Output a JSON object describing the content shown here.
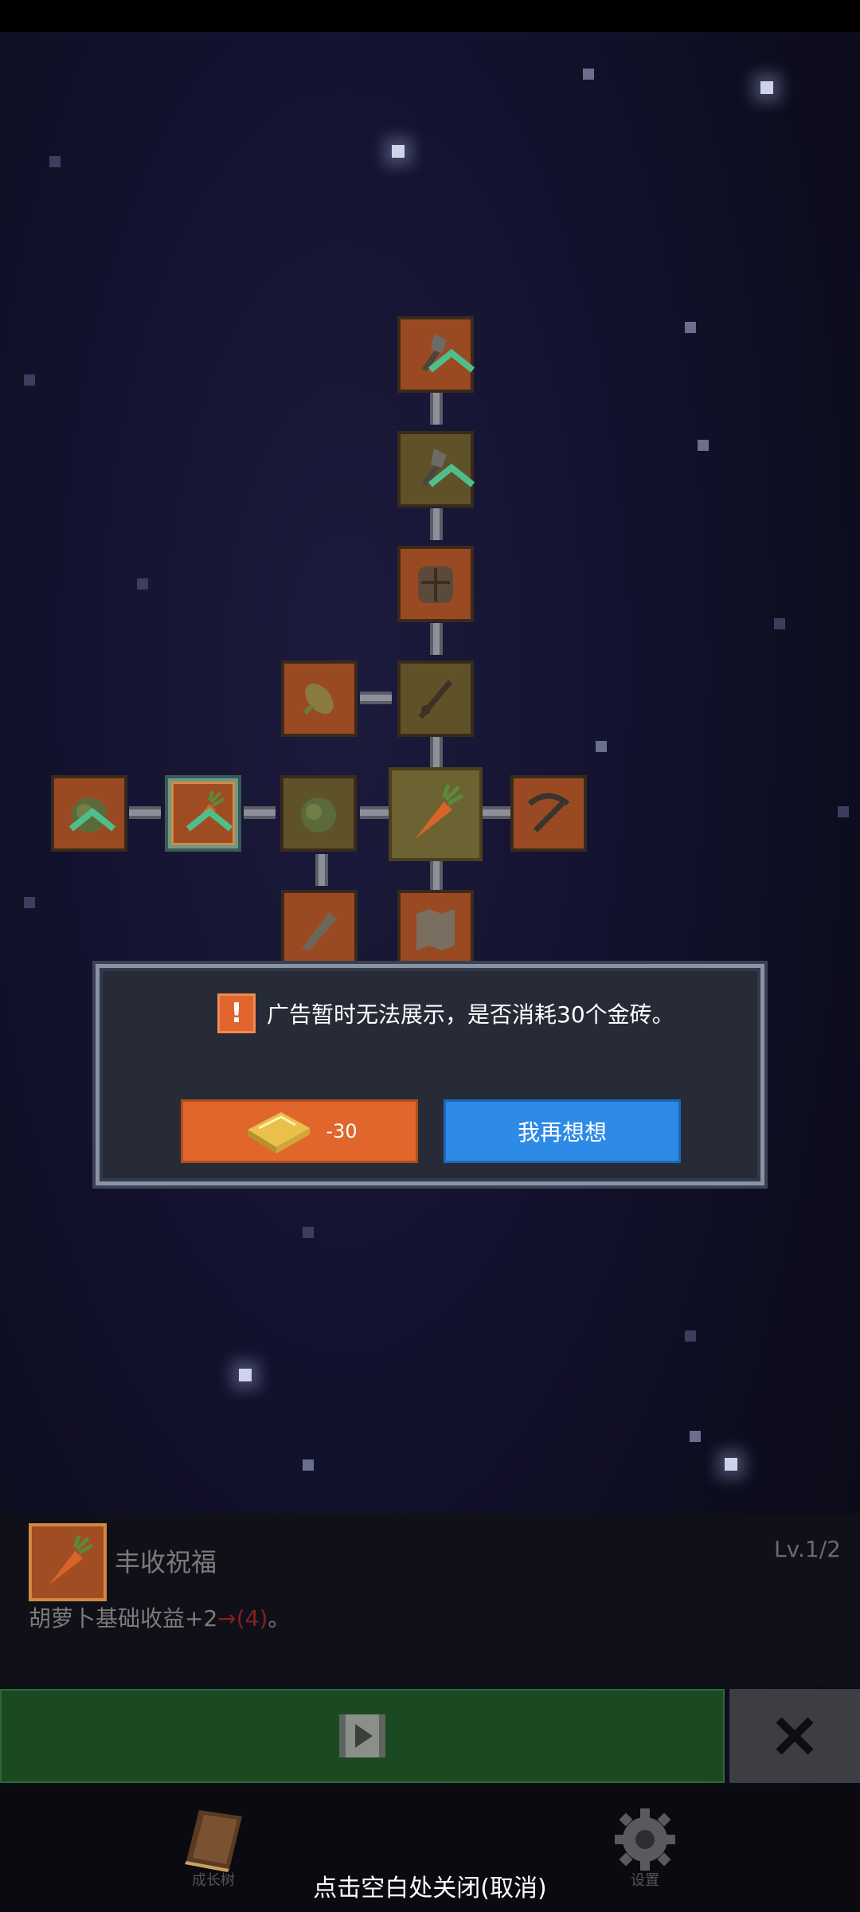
{
  "dialog": {
    "message": "广告暂时无法展示，是否消耗30个金砖。",
    "gold_button_label": "-30",
    "think_button_label": "我再想想"
  },
  "info": {
    "title": "丰收祝福",
    "level": "Lv.1/2",
    "desc_base": "胡萝卜基础收益+2",
    "desc_arrow": "→(4)",
    "desc_end": "。"
  },
  "nav": {
    "growth_tree": "成长树",
    "settings": "设置"
  },
  "hint": "点击空白处关闭(取消)",
  "colors": {
    "accent_orange": "#e0662c",
    "accent_blue": "#2d8ae6",
    "panel_green": "#1b4a22"
  },
  "icons": [
    "shovel-icon",
    "backpack-icon",
    "corn-icon",
    "staff-icon",
    "cabbage-icon",
    "carrot-icon",
    "pickaxe-icon",
    "club-icon",
    "map-icon",
    "gold-bar-icon",
    "play-video-icon",
    "close-icon",
    "book-icon",
    "gear-icon",
    "warning-icon"
  ]
}
